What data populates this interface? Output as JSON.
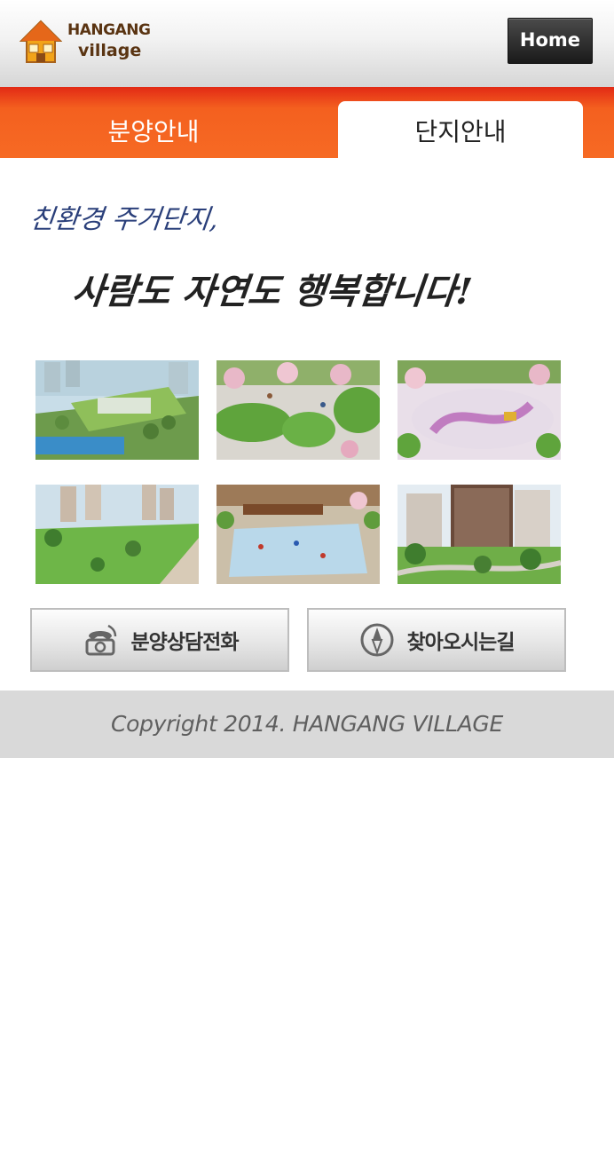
{
  "header": {
    "logo_line1": "HANGANG",
    "logo_line2": "village",
    "home_label": "Home"
  },
  "tabs": [
    {
      "label": "분양안내",
      "active": false
    },
    {
      "label": "단지안내",
      "active": true
    }
  ],
  "slogan": {
    "line1": "친환경 주거단지,",
    "line2": "사람도 자연도 행복합니다!"
  },
  "buttons": {
    "call_label": "분양상담전화",
    "call_icon": "phone-icon",
    "map_label": "찾아오시는길",
    "map_icon": "compass-icon"
  },
  "footer": {
    "copyright": "Copyright 2014. HANGANG VILLAGE"
  },
  "colors": {
    "tab_bar": "#f4601f",
    "header_brown": "#5a3412",
    "footer_bg": "#d9d9d9"
  }
}
